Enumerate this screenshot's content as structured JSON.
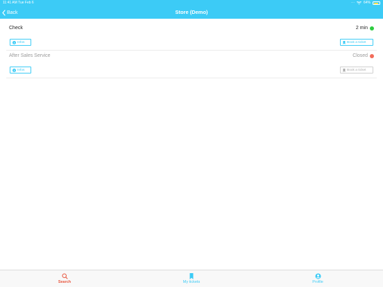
{
  "status_bar": {
    "time": "11:41 AM",
    "date": "Tue Feb 6",
    "battery": "64%"
  },
  "nav": {
    "back_label": "Back",
    "title": "Store (Demo)"
  },
  "services": [
    {
      "name": "Check",
      "status": "2 min",
      "status_color": "#2ecc40",
      "infos_label": "Infos",
      "book_label": "Book a ticket",
      "enabled": true
    },
    {
      "name": "After Sales Service",
      "status": "Closed",
      "status_color": "#f26c5a",
      "infos_label": "Infos",
      "book_label": "Book a ticket",
      "enabled": false
    }
  ],
  "tabbar": {
    "tabs": [
      {
        "label": "Search",
        "icon": "search-icon",
        "active": true
      },
      {
        "label": "My tickets",
        "icon": "bookmark-icon",
        "active": false
      },
      {
        "label": "Profile",
        "icon": "profile-icon",
        "active": false
      }
    ]
  },
  "colors": {
    "accent": "#3ccbf6",
    "active_tab": "#e8563e"
  }
}
